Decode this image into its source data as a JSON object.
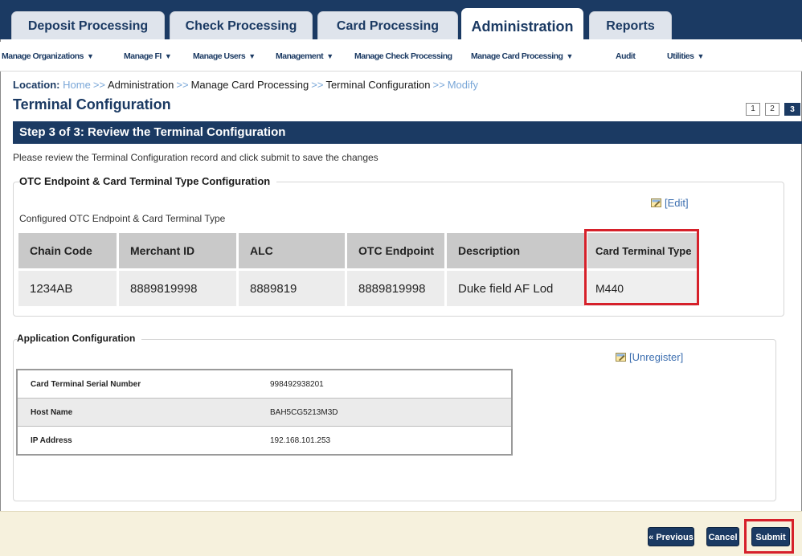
{
  "tabs": [
    {
      "label": "Deposit Processing"
    },
    {
      "label": "Check Processing"
    },
    {
      "label": "Card Processing"
    },
    {
      "label": "Administration"
    },
    {
      "label": "Reports"
    }
  ],
  "active_tab": "Administration",
  "menu": [
    {
      "label": "Manage Organizations",
      "dropdown": true
    },
    {
      "label": "Manage FI",
      "dropdown": true
    },
    {
      "label": "Manage Users",
      "dropdown": true
    },
    {
      "label": "Management",
      "dropdown": true
    },
    {
      "label": "Manage Check Processing",
      "dropdown": false
    },
    {
      "label": "Manage Card Processing",
      "dropdown": true
    },
    {
      "label": "Audit",
      "dropdown": false
    },
    {
      "label": "Utilities",
      "dropdown": true
    }
  ],
  "location": {
    "label": "Location:",
    "crumbs": [
      "Home",
      "Administration",
      "Manage Card Processing",
      "Terminal Configuration",
      "Modify"
    ],
    "separator": ">>"
  },
  "page_title": "Terminal Configuration",
  "steps": [
    "1",
    "2",
    "3"
  ],
  "current_step": "3",
  "step_header": "Step 3 of 3: Review the Terminal Configuration",
  "instructions": "Please review the Terminal Configuration record and click submit to save the changes",
  "otc_section": {
    "legend": "OTC Endpoint & Card Terminal Type Configuration",
    "edit_label": "[Edit]",
    "caption": "Configured OTC Endpoint & Card Terminal Type",
    "columns": [
      "Chain Code",
      "Merchant ID",
      "ALC",
      "OTC Endpoint",
      "Description",
      "Card Terminal Type"
    ],
    "row": [
      "1234AB",
      "8889819998",
      "8889819",
      "8889819998",
      "Duke field AF Lod",
      "M440"
    ]
  },
  "app_section": {
    "legend": "Application Configuration",
    "unregister_label": "[Unregister]",
    "rows": [
      {
        "key": "Card Terminal Serial Number",
        "value": "998492938201"
      },
      {
        "key": "Host Name",
        "value": "BAH5CG5213M3D"
      },
      {
        "key": "IP Address",
        "value": "192.168.101.253"
      }
    ]
  },
  "buttons": {
    "previous": "« Previous",
    "cancel": "Cancel",
    "submit": "Submit"
  },
  "colors": {
    "brand": "#1b3a63",
    "link": "#3d6fb0",
    "highlight": "#d6202a",
    "footer": "#f6f1dd"
  },
  "icons": {
    "edit": "edit-icon",
    "unregister": "unregister-icon",
    "menu_caret": "chevron-down-icon"
  }
}
